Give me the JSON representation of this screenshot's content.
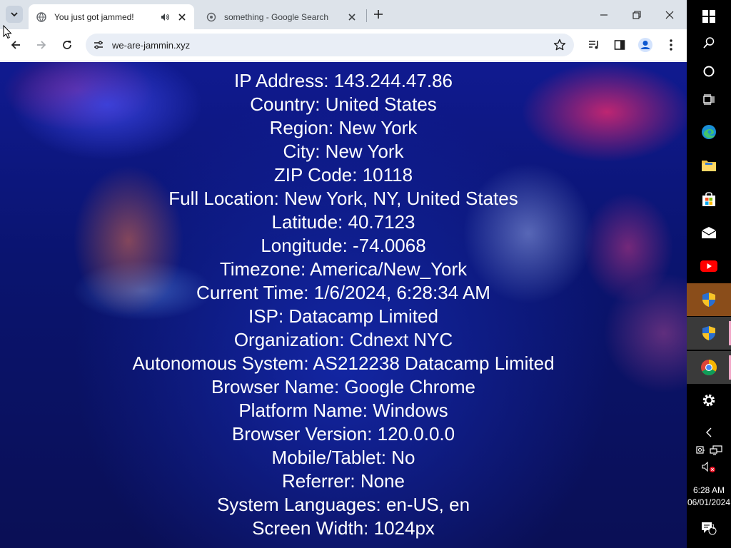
{
  "tabs": [
    {
      "title": "You just got jammed!",
      "active": true,
      "audio": true
    },
    {
      "title": "something - Google Search",
      "active": false
    }
  ],
  "address_bar": {
    "url": "we-are-jammin.xyz"
  },
  "info_lines": [
    "IP Address: 143.244.47.86",
    "Country: United States",
    "Region: New York",
    "City: New York",
    "ZIP Code: 10118",
    "Full Location: New York, NY, United States",
    "Latitude: 40.7123",
    "Longitude: -74.0068",
    "Timezone: America/New_York",
    "Current Time: 1/6/2024, 6:28:34 AM",
    "ISP: Datacamp Limited",
    "Organization: Cdnext NYC",
    "Autonomous System: AS212238 Datacamp Limited",
    "Browser Name: Google Chrome",
    "Platform Name: Windows",
    "Browser Version: 120.0.0.0",
    "Mobile/Tablet: No",
    "Referrer: None",
    "System Languages: en-US, en",
    "Screen Width: 1024px"
  ],
  "taskbar": {
    "clock_time": "6:28 AM",
    "clock_date": "06/01/2024",
    "notification_count": "1"
  },
  "colors": {
    "tabstrip_bg": "#dde3ea",
    "omnibox_bg": "#e9eef6",
    "taskbar_highlight": "#8a4d1a",
    "page_text": "#ffffff"
  }
}
